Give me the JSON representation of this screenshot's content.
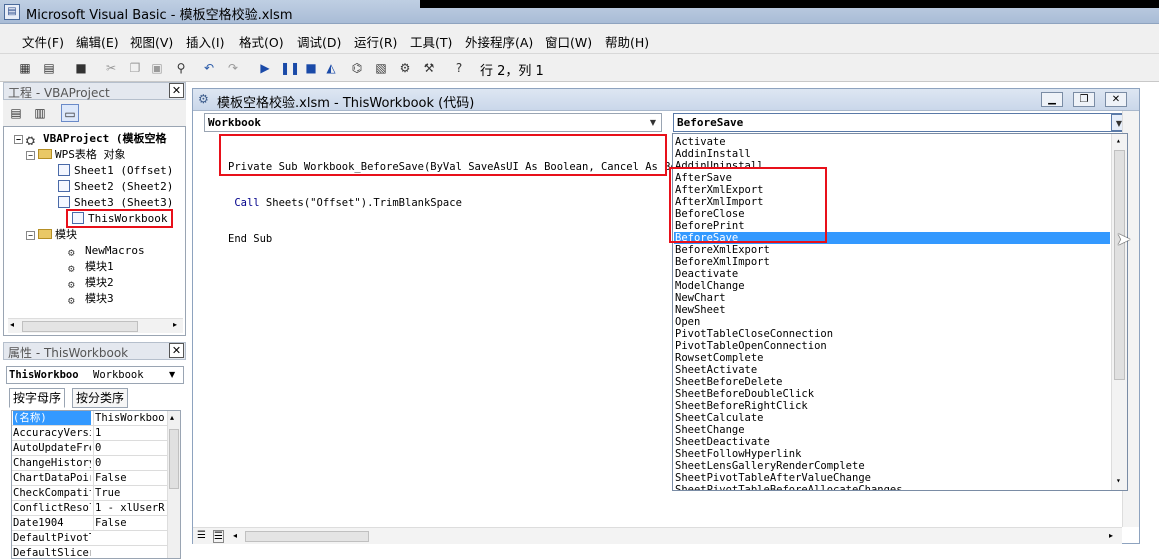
{
  "window": {
    "title": "Microsoft Visual Basic - 模板空格校验.xlsm"
  },
  "menubar": {
    "items": [
      "文件(F)",
      "编辑(E)",
      "视图(V)",
      "插入(I)",
      "格式(O)",
      "调试(D)",
      "运行(R)",
      "工具(T)",
      "外接程序(A)",
      "窗口(W)",
      "帮助(H)"
    ]
  },
  "toolbar": {
    "cursor_position": "行 2，列 1"
  },
  "project": {
    "title": "工程 - VBAProject",
    "tree": [
      {
        "label": "VBAProject (模板空格",
        "level": 0
      },
      {
        "label": "WPS表格 对象",
        "level": 1
      },
      {
        "label": "Sheet1 (Offset)",
        "level": 2
      },
      {
        "label": "Sheet2 (Sheet2)",
        "level": 2
      },
      {
        "label": "Sheet3 (Sheet3)",
        "level": 2
      },
      {
        "label": "ThisWorkbook",
        "level": 2
      },
      {
        "label": "模块",
        "level": 1
      },
      {
        "label": "NewMacros",
        "level": 2
      },
      {
        "label": "模块1",
        "level": 2
      },
      {
        "label": "模块2",
        "level": 2
      },
      {
        "label": "模块3",
        "level": 2
      }
    ]
  },
  "properties": {
    "title": "属性 - ThisWorkbook",
    "object_name": "ThisWorkboo",
    "object_type": "Workbook",
    "tabs": [
      "按字母序",
      "按分类序"
    ],
    "rows": [
      {
        "key": "(名称)",
        "value": "ThisWorkbook"
      },
      {
        "key": "AccuracyVersi",
        "value": "1"
      },
      {
        "key": "AutoUpdateFre",
        "value": "0"
      },
      {
        "key": "ChangeHistory",
        "value": "0"
      },
      {
        "key": "ChartDataPoir",
        "value": "False"
      },
      {
        "key": "CheckCompatit",
        "value": "True"
      },
      {
        "key": "ConflictResol",
        "value": "1 - xlUserRe"
      },
      {
        "key": "Date1904",
        "value": "False"
      },
      {
        "key": "DefaultPivotT",
        "value": ""
      },
      {
        "key": "DefaultSlicer",
        "value": ""
      }
    ]
  },
  "code_window": {
    "title": "模板空格校验.xlsm - ThisWorkbook (代码)",
    "object_combo": "Workbook",
    "procedure_combo": "BeforeSave",
    "code_lines": [
      "Private Sub Workbook_BeforeSave(ByVal SaveAsUI As Boolean, Cancel As Boole",
      " Call Sheets(\"Offset\").TrimBlankSpace",
      "End Sub"
    ],
    "dropdown_items": [
      "Activate",
      "AddinInstall",
      "AddinUninstall",
      "AfterSave",
      "AfterXmlExport",
      "AfterXmlImport",
      "BeforeClose",
      "BeforePrint",
      "BeforeSave",
      "BeforeXmlExport",
      "BeforeXmlImport",
      "Deactivate",
      "ModelChange",
      "NewChart",
      "NewSheet",
      "Open",
      "PivotTableCloseConnection",
      "PivotTableOpenConnection",
      "RowsetComplete",
      "SheetActivate",
      "SheetBeforeDelete",
      "SheetBeforeDoubleClick",
      "SheetBeforeRightClick",
      "SheetCalculate",
      "SheetChange",
      "SheetDeactivate",
      "SheetFollowHyperlink",
      "SheetLensGalleryRenderComplete",
      "SheetPivotTableAfterValueChange",
      "SheetPivotTableBeforeAllocateChanges"
    ],
    "selected_index": 8
  },
  "colors": {
    "highlight": "#3399ff",
    "annotation": "#e8101a"
  }
}
